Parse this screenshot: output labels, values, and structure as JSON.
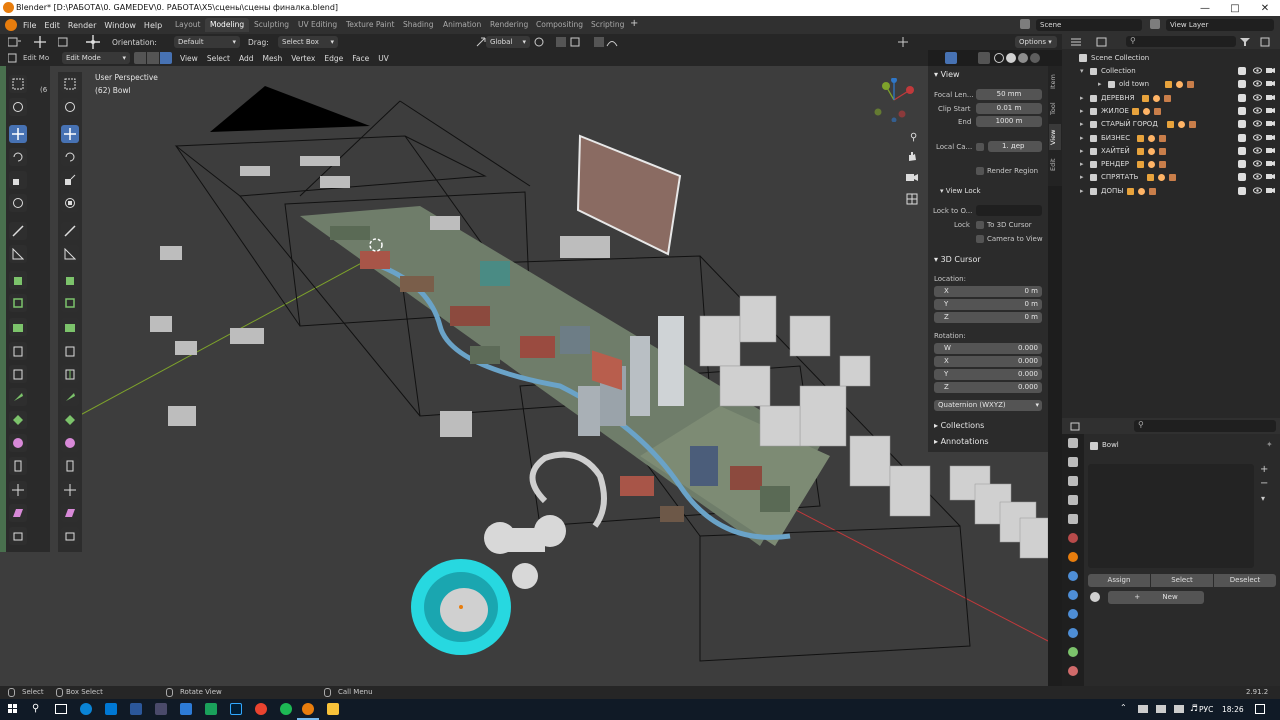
{
  "window": {
    "title": "Blender* [D:\\РАБОТА\\0. GAMEDEV\\0. РАБОТА\\X5\\сцены\\сцены финалка.blend]",
    "controls": [
      "minimize-icon",
      "maximize-icon",
      "close-icon"
    ]
  },
  "menu": [
    "File",
    "Edit",
    "Render",
    "Window",
    "Help"
  ],
  "workspaces": [
    "Layout",
    "Modeling",
    "Sculpting",
    "UV Editing",
    "Texture Paint",
    "Shading",
    "Animation",
    "Rendering",
    "Compositing",
    "Scripting"
  ],
  "active_workspace": "Modeling",
  "scene": {
    "label": "Scene",
    "view_layer": "View Layer"
  },
  "header1": {
    "orientation_label": "Orientation:",
    "orientation_value": "Default",
    "drag_label": "Drag:",
    "drag_value": "Select Box",
    "transform_value": "Global",
    "options_label": "Options"
  },
  "header2": {
    "mode": "Edit Mode",
    "menus": [
      "View",
      "Select",
      "Add",
      "Mesh",
      "Vertex",
      "Edge",
      "Face",
      "UV"
    ]
  },
  "viewport": {
    "perspective": "User Perspective",
    "object_info": "(62) Bowl",
    "gizmo_axes": [
      "X",
      "Y",
      "Z"
    ]
  },
  "left_strip": {
    "label_top": "Edit Mo",
    "label_num": "(6"
  },
  "npanel": {
    "tabs": [
      "Item",
      "Tool",
      "View",
      "Edit"
    ],
    "active_tab": "View",
    "view_title": "View",
    "focal_length_label": "Focal Len...",
    "focal_length_value": "50 mm",
    "clip_start_label": "Clip Start",
    "clip_start_value": "0.01 m",
    "clip_end_label": "End",
    "clip_end_value": "1000 m",
    "local_camera_label": "Local Ca...",
    "local_camera_value": "1. дер",
    "render_region_label": "Render Region",
    "view_lock_title": "View Lock",
    "lock_to_object_label": "Lock to O...",
    "lock_label": "Lock",
    "to_3d_cursor_label": "To 3D Cursor",
    "camera_to_view_label": "Camera to View",
    "cursor_title": "3D Cursor",
    "location_label": "Location:",
    "location": [
      {
        "axis": "X",
        "value": "0 m"
      },
      {
        "axis": "Y",
        "value": "0 m"
      },
      {
        "axis": "Z",
        "value": "0 m"
      }
    ],
    "rotation_label": "Rotation:",
    "rotation": [
      {
        "axis": "W",
        "value": "0.000"
      },
      {
        "axis": "X",
        "value": "0.000"
      },
      {
        "axis": "Y",
        "value": "0.000"
      },
      {
        "axis": "Z",
        "value": "0.000"
      }
    ],
    "rotation_mode": "Quaternion (WXYZ)",
    "collections_title": "Collections",
    "annotations_title": "Annotations"
  },
  "outliner": {
    "root": "Scene Collection",
    "items": [
      {
        "name": "Collection",
        "indent": 1,
        "expanded": true
      },
      {
        "name": "old town",
        "indent": 2,
        "expanded": false
      },
      {
        "name": "ДЕРЕВНЯ",
        "indent": 1,
        "expanded": false
      },
      {
        "name": "ЖИЛОЕ",
        "indent": 1,
        "expanded": false
      },
      {
        "name": "СТАРЫЙ ГОРОД",
        "indent": 1,
        "expanded": false
      },
      {
        "name": "БИЗНЕС",
        "indent": 1,
        "expanded": false
      },
      {
        "name": "ХАЙТЕЙ",
        "indent": 1,
        "expanded": false
      },
      {
        "name": "РЕНДЕР",
        "indent": 1,
        "expanded": false
      },
      {
        "name": "СПРЯТАТЬ",
        "indent": 1,
        "expanded": false
      },
      {
        "name": "ДОПЫ",
        "indent": 1,
        "expanded": false
      }
    ]
  },
  "properties": {
    "object_name": "Bowl",
    "assign_label": "Assign",
    "select_label": "Select",
    "deselect_label": "Deselect",
    "new_label": "New"
  },
  "statusbar": {
    "select": "Select",
    "box_select": "Box Select",
    "rotate_view": "Rotate View",
    "call_menu": "Call Menu",
    "version": "2.91.2"
  },
  "taskbar": {
    "language": "РУС",
    "time": "18:26"
  },
  "colors": {
    "accent": "#4772b3",
    "active_tab": "#3d3d3d",
    "viewport_bg": "#3d3d3d",
    "selected_mesh": "#27d8e0",
    "axis_red": "#c0393b",
    "axis_green": "#7ea32b",
    "blender_orange": "#e87d0d"
  }
}
